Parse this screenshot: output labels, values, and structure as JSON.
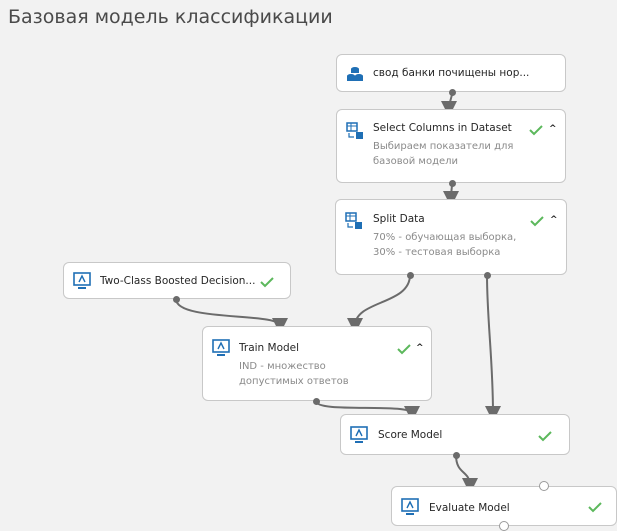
{
  "page": {
    "title": "Базовая модель классификации"
  },
  "nodes": {
    "dataset": {
      "title": "свод банки почищены нор..."
    },
    "select_columns": {
      "title": "Select Columns in Dataset",
      "desc_line1": "Выбираем показатели для",
      "desc_line2": "базовой модели"
    },
    "split_data": {
      "title": "Split Data",
      "desc_line1": "70% - обучающая выборка,",
      "desc_line2": "30% - тестовая выборка"
    },
    "boosted_tree": {
      "title": "Two-Class Boosted Decision..."
    },
    "train_model": {
      "title": "Train Model",
      "desc_line1": "IND - множество",
      "desc_line2": "допустимых ответов"
    },
    "score_model": {
      "title": "Score Model"
    },
    "evaluate_model": {
      "title": "Evaluate Model"
    }
  },
  "colors": {
    "check": "#5cb85c",
    "icon_blue": "#1f6fb5",
    "edge": "#6b6b6b"
  },
  "icons": {
    "dataset": "database-icon",
    "transform": "table-transform-icon",
    "module": "monitor-icon",
    "status": "checkmark-icon",
    "collapse": "caret-up-icon"
  }
}
